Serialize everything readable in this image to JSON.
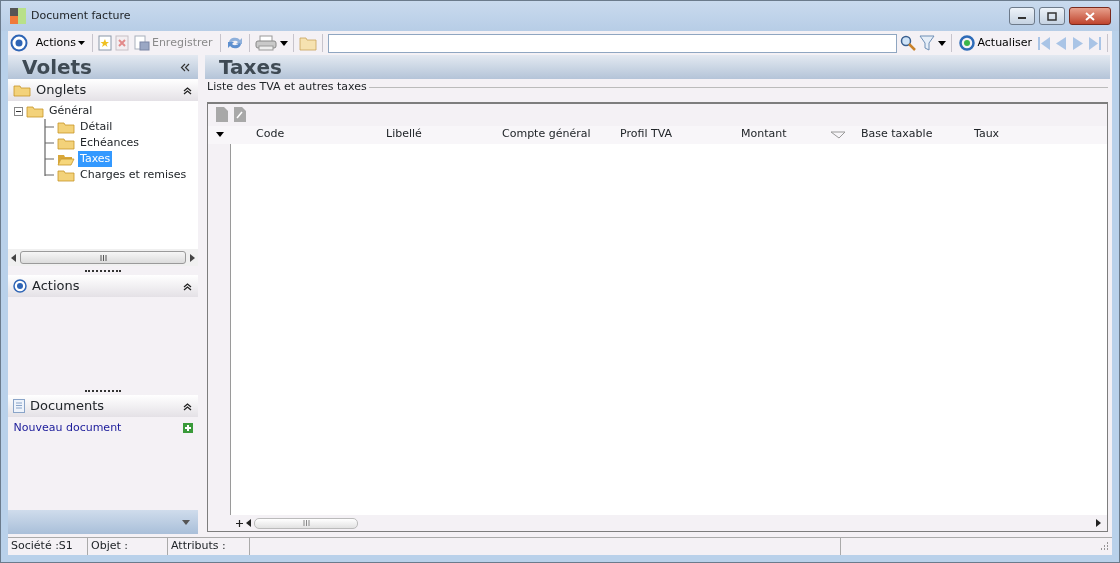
{
  "window": {
    "title": "Document facture"
  },
  "toolbar": {
    "actions_menu": "Actions",
    "save": {
      "label": "Enregistrer",
      "disabled": true
    },
    "refresh": "Actualiser"
  },
  "panes": {
    "title": "Volets",
    "sections": [
      {
        "kind": "tree",
        "title": "Onglets",
        "tree": [
          {
            "label": "Général",
            "expanded": true,
            "selected": false,
            "children": [
              {
                "label": "Détail",
                "selected": false
              },
              {
                "label": "Echéances",
                "selected": false
              },
              {
                "label": "Taxes",
                "selected": true
              },
              {
                "label": "Charges et remises",
                "selected": false
              }
            ]
          }
        ]
      },
      {
        "kind": "actions",
        "title": "Actions"
      },
      {
        "kind": "documents",
        "title": "Documents",
        "link": "Nouveau document"
      }
    ]
  },
  "content": {
    "title": "Taxes",
    "group_title": "Liste des TVA et autres taxes",
    "columns": [
      "Code",
      "Libellé",
      "Compte général",
      "Profil TVA",
      "Montant",
      "Base taxable",
      "Taux"
    ]
  },
  "status_bar": [
    "Société :S1",
    "Objet :",
    "Attributs :"
  ]
}
